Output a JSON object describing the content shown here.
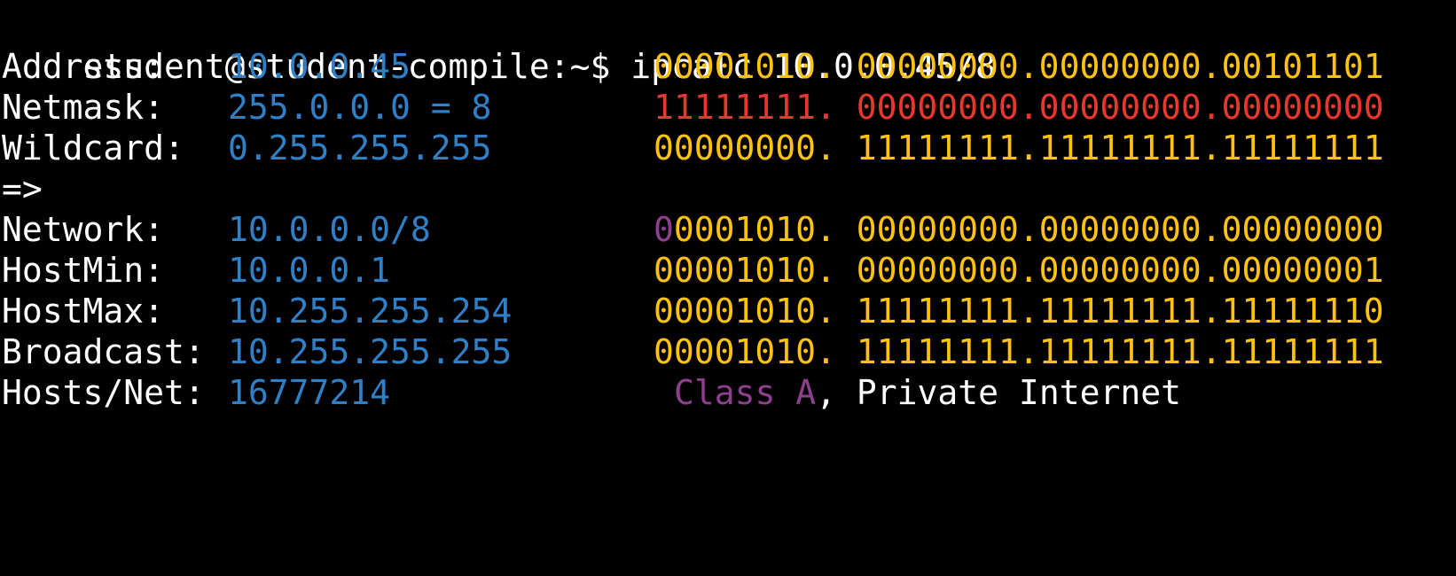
{
  "terminal": {
    "prompt": "student@student-compile:~$ ",
    "command": "ipcalc 10.0.0.45/8",
    "colors": {
      "background": "#000000",
      "text": "#ffffff",
      "value": "#2f80c6",
      "bits": "#ffc20e",
      "netmask_bits": "#e8372c",
      "class_bits": "#8e3f8e"
    },
    "address": {
      "label": "Address:",
      "value": "10.0.0.45",
      "bits_a": "00001010.",
      "bits_b": " 00000000.00000000.00101101"
    },
    "netmask": {
      "label": "Netmask:",
      "value": "255.0.0.0 = 8",
      "bits_a": "11111111.",
      "bits_b": " 00000000.00000000.00000000"
    },
    "wildcard": {
      "label": "Wildcard:",
      "value": "0.255.255.255",
      "bits_a": "00000000.",
      "bits_b": " 11111111.11111111.11111111"
    },
    "arrow": "=>",
    "network": {
      "label": "Network:",
      "value": "10.0.0.0/8",
      "bits_class": "0",
      "bits_a": "0001010.",
      "bits_b": " 00000000.00000000.00000000"
    },
    "hostmin": {
      "label": "HostMin:",
      "value": "10.0.0.1",
      "bits_a": "00001010.",
      "bits_b": " 00000000.00000000.00000001"
    },
    "hostmax": {
      "label": "HostMax:",
      "value": "10.255.255.254",
      "bits_a": "00001010.",
      "bits_b": " 11111111.11111111.11111110"
    },
    "broadcast": {
      "label": "Broadcast:",
      "value": "10.255.255.255",
      "bits_a": "00001010.",
      "bits_b": " 11111111.11111111.11111111"
    },
    "hosts": {
      "label": "Hosts/Net:",
      "value": "16777214",
      "class": "Class A",
      "note": ", Private Internet"
    }
  }
}
